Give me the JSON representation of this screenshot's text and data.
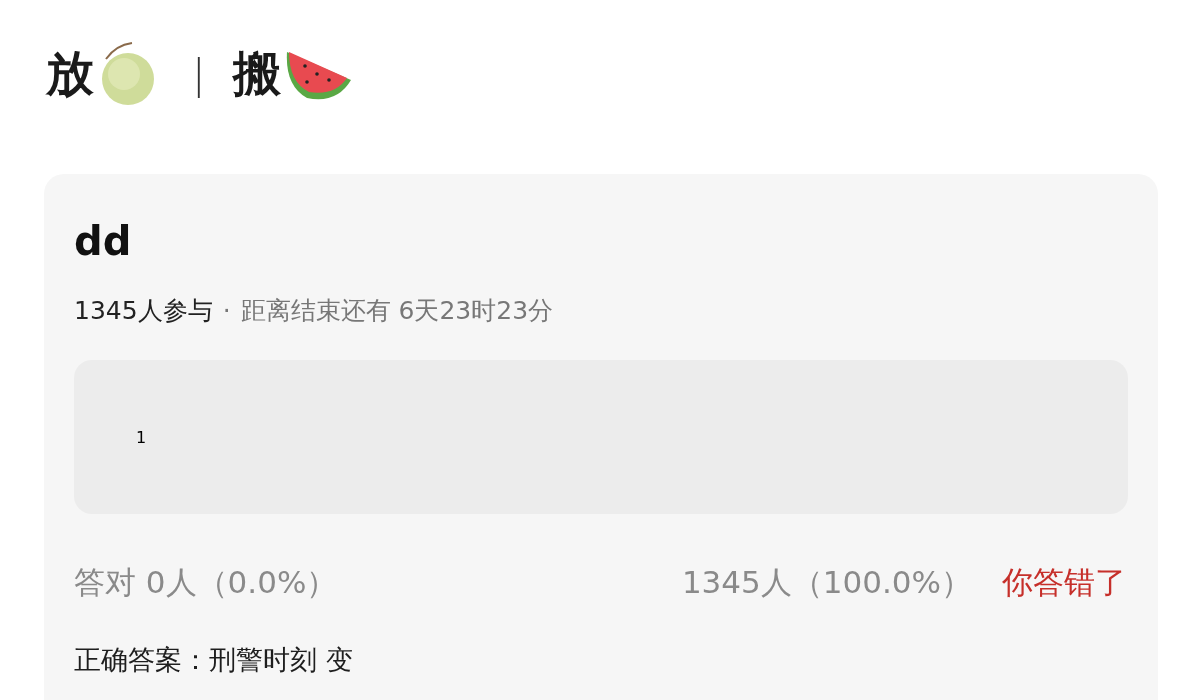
{
  "header": {
    "left": "放",
    "separator": "|",
    "right": "搬"
  },
  "poll": {
    "title": "dd",
    "participants": "1345人参与",
    "meta_separator": "·",
    "deadline": "距离结束还有 6天23时23分",
    "options": [
      {
        "label": "1"
      }
    ],
    "stats": {
      "correct": "答对 0人（0.0%）",
      "count": "1345人（100.0%）",
      "result": "你答错了"
    },
    "answer": "正确答案：刑警时刻 变"
  }
}
